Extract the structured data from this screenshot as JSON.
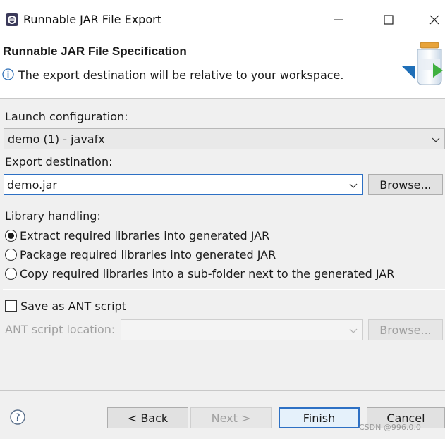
{
  "window": {
    "title": "Runnable JAR File Export"
  },
  "header": {
    "title": "Runnable JAR File Specification",
    "message": "The export destination will be relative to your workspace."
  },
  "launch": {
    "label": "Launch configuration:",
    "value": "demo (1) - javafx"
  },
  "export": {
    "label": "Export destination:",
    "value": "demo.jar",
    "browse_label": "Browse..."
  },
  "library": {
    "label": "Library handling:",
    "options": [
      {
        "label": "Extract required libraries into generated JAR",
        "checked": true
      },
      {
        "label": "Package required libraries into generated JAR",
        "checked": false
      },
      {
        "label": "Copy required libraries into a sub-folder next to the generated JAR",
        "checked": false
      }
    ]
  },
  "ant": {
    "save_label": "Save as ANT script",
    "location_label": "ANT script location:",
    "location_value": "",
    "browse_label": "Browse..."
  },
  "buttons": {
    "back": "< Back",
    "next": "Next >",
    "finish": "Finish",
    "cancel": "Cancel"
  },
  "watermark": "CSDN @996.0.0"
}
